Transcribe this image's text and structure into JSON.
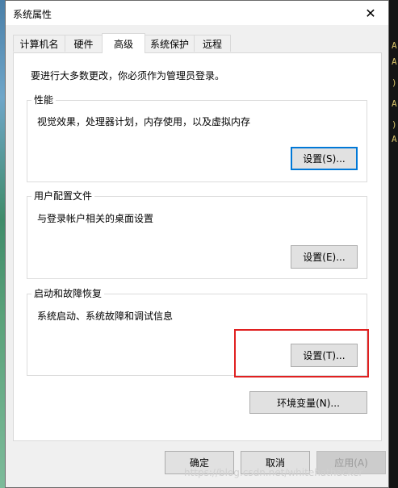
{
  "window": {
    "title": "系统属性",
    "close_glyph": "✕"
  },
  "tabs": [
    {
      "label": "计算机名"
    },
    {
      "label": "硬件"
    },
    {
      "label": "高级",
      "active": true
    },
    {
      "label": "系统保护"
    },
    {
      "label": "远程"
    }
  ],
  "main": {
    "admin_note": "要进行大多数更改，你必须作为管理员登录。",
    "performance": {
      "title": "性能",
      "desc": "视觉效果，处理器计划，内存使用，以及虚拟内存",
      "button": "设置(S)..."
    },
    "user_profiles": {
      "title": "用户配置文件",
      "desc": "与登录帐户相关的桌面设置",
      "button": "设置(E)..."
    },
    "startup_recovery": {
      "title": "启动和故障恢复",
      "desc": "系统启动、系统故障和调试信息",
      "button": "设置(T)..."
    },
    "env_button": "环境变量(N)..."
  },
  "footer": {
    "ok": "确定",
    "cancel": "取消",
    "apply": "应用(A)"
  },
  "watermark": "https://blog.csdn.net/whitehathacker",
  "colors": {
    "highlight": "#e02020",
    "focus": "#0078d7"
  }
}
